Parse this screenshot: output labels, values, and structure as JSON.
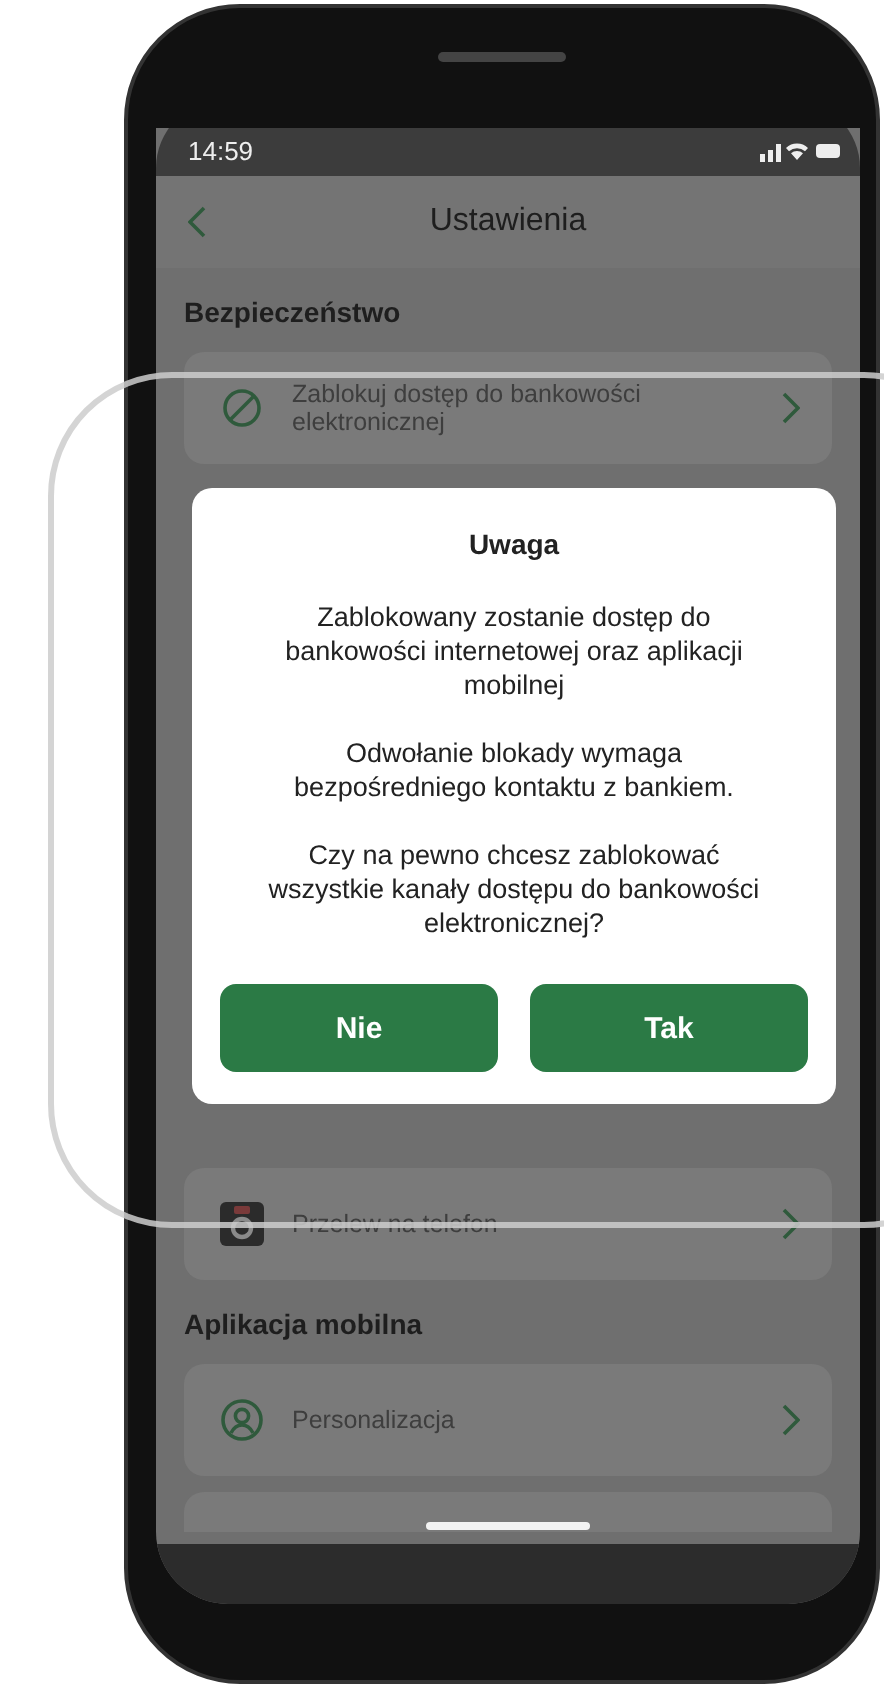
{
  "status_bar": {
    "time": "14:59"
  },
  "header": {
    "title": "Ustawienia"
  },
  "sections": [
    {
      "title": "Bezpieczeństwo",
      "items": [
        {
          "kind": "blocked",
          "label": "Zablokuj dostęp do bankowości elektronicznej"
        }
      ]
    },
    {
      "items": [
        {
          "kind": "transfer",
          "label": "Przelew na telefon"
        }
      ]
    },
    {
      "title": "Aplikacja mobilna",
      "items": [
        {
          "kind": "profile",
          "label": "Personalizacja"
        }
      ]
    }
  ],
  "dialog": {
    "title": "Uwaga",
    "paragraphs": [
      "Zablokowany zostanie dostęp do bankowości internetowej oraz aplikacji mobilnej",
      "Odwołanie blokady wymaga bezpośredniego kontaktu z bankiem.",
      "Czy na pewno chcesz zablokować wszystkie kanały dostępu do bankowości elektronicznej?"
    ],
    "buttons": [
      "Nie",
      "Tak"
    ]
  }
}
